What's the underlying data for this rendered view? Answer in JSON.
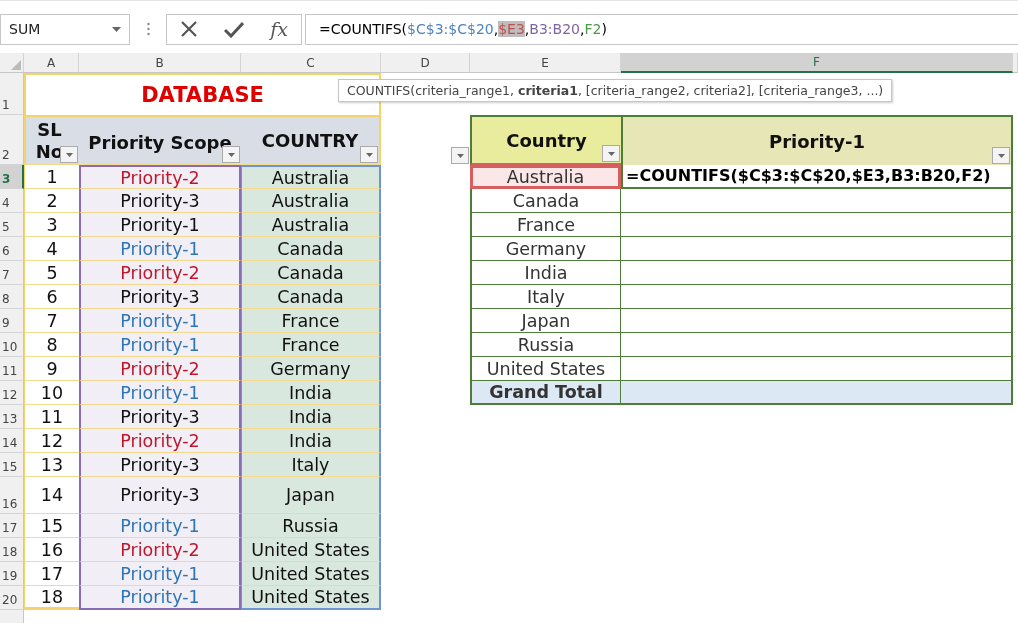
{
  "name_box": {
    "value": "SUM"
  },
  "formula_bar": {
    "fx_label": "fx",
    "segments": [
      {
        "kind": "text",
        "text": "=COUNTIFS(",
        "highlighted": false
      },
      {
        "kind": "reference",
        "text": "$C$3:$C$20",
        "color": "#4f81bd",
        "highlighted": false
      },
      {
        "kind": "text",
        "text": ",",
        "highlighted": false
      },
      {
        "kind": "reference",
        "text": "$E3",
        "color": "#c0504d",
        "highlighted": true
      },
      {
        "kind": "text",
        "text": ",",
        "highlighted": false
      },
      {
        "kind": "reference",
        "text": "B3:B20",
        "color": "#8064a2",
        "highlighted": false
      },
      {
        "kind": "text",
        "text": ",",
        "highlighted": false
      },
      {
        "kind": "reference",
        "text": "F2",
        "color": "#4c9a4c",
        "highlighted": false
      },
      {
        "kind": "text",
        "text": ")",
        "highlighted": false
      }
    ]
  },
  "tooltip": "COUNTIFS(criteria_range1, **criteria1**, [criteria_range2, criteria2], [criteria_range3, ...)",
  "column_headers": [
    {
      "label": "A",
      "selected": false
    },
    {
      "label": "B",
      "selected": false
    },
    {
      "label": "C",
      "selected": false
    },
    {
      "label": "D",
      "selected": false
    },
    {
      "label": "E",
      "selected": false
    },
    {
      "label": "F",
      "selected": true
    }
  ],
  "row_headers": [
    {
      "label": "1",
      "selected": false
    },
    {
      "label": "2",
      "selected": false
    },
    {
      "label": "3",
      "selected": true
    },
    {
      "label": "4",
      "selected": false
    },
    {
      "label": "5",
      "selected": false
    },
    {
      "label": "6",
      "selected": false
    },
    {
      "label": "7",
      "selected": false
    },
    {
      "label": "8",
      "selected": false
    },
    {
      "label": "9",
      "selected": false
    },
    {
      "label": "10",
      "selected": false
    },
    {
      "label": "11",
      "selected": false
    },
    {
      "label": "12",
      "selected": false
    },
    {
      "label": "13",
      "selected": false
    },
    {
      "label": "14",
      "selected": false
    },
    {
      "label": "15",
      "selected": false
    },
    {
      "label": "16",
      "selected": false
    },
    {
      "label": "17",
      "selected": false
    },
    {
      "label": "18",
      "selected": false
    },
    {
      "label": "19",
      "selected": false
    },
    {
      "label": "20",
      "selected": false
    }
  ],
  "database": {
    "title": "DATABASE",
    "headers": [
      "SL No",
      "Priority Scope",
      "COUNTRY"
    ],
    "rows": [
      {
        "sl": "1",
        "priority": "Priority-2",
        "color": "#c0162c",
        "country": "Australia"
      },
      {
        "sl": "2",
        "priority": "Priority-3",
        "color": "#111111",
        "country": "Australia"
      },
      {
        "sl": "3",
        "priority": "Priority-1",
        "color": "#111111",
        "country": "Australia"
      },
      {
        "sl": "4",
        "priority": "Priority-1",
        "color": "#2e75b6",
        "country": "Canada"
      },
      {
        "sl": "5",
        "priority": "Priority-2",
        "color": "#c0162c",
        "country": "Canada"
      },
      {
        "sl": "6",
        "priority": "Priority-3",
        "color": "#111111",
        "country": "Canada"
      },
      {
        "sl": "7",
        "priority": "Priority-1",
        "color": "#2e75b6",
        "country": "France"
      },
      {
        "sl": "8",
        "priority": "Priority-1",
        "color": "#2e75b6",
        "country": "France"
      },
      {
        "sl": "9",
        "priority": "Priority-2",
        "color": "#c0162c",
        "country": "Germany"
      },
      {
        "sl": "10",
        "priority": "Priority-1",
        "color": "#2e75b6",
        "country": "India"
      },
      {
        "sl": "11",
        "priority": "Priority-3",
        "color": "#111111",
        "country": "India"
      },
      {
        "sl": "12",
        "priority": "Priority-2",
        "color": "#c0162c",
        "country": "India"
      },
      {
        "sl": "13",
        "priority": "Priority-3",
        "color": "#111111",
        "country": "Italy"
      },
      {
        "sl": "14",
        "priority": "Priority-3",
        "color": "#111111",
        "country": "Japan"
      },
      {
        "sl": "15",
        "priority": "Priority-1",
        "color": "#2e75b6",
        "country": "Russia"
      },
      {
        "sl": "16",
        "priority": "Priority-2",
        "color": "#c0162c",
        "country": "United States"
      },
      {
        "sl": "17",
        "priority": "Priority-1",
        "color": "#2e75b6",
        "country": "United States"
      },
      {
        "sl": "18",
        "priority": "Priority-1",
        "color": "#2e75b6",
        "country": "United States"
      }
    ]
  },
  "pivot": {
    "headers": [
      "Country",
      "Priority-1"
    ],
    "rows": [
      "Australia",
      "Canada",
      "France",
      "Germany",
      "India",
      "Italy",
      "Japan",
      "Russia",
      "United States"
    ],
    "total_label": "Grand Total",
    "active_formula": "=COUNTIFS($C$3:$C$20,$E3,B3:B20,F2)"
  }
}
